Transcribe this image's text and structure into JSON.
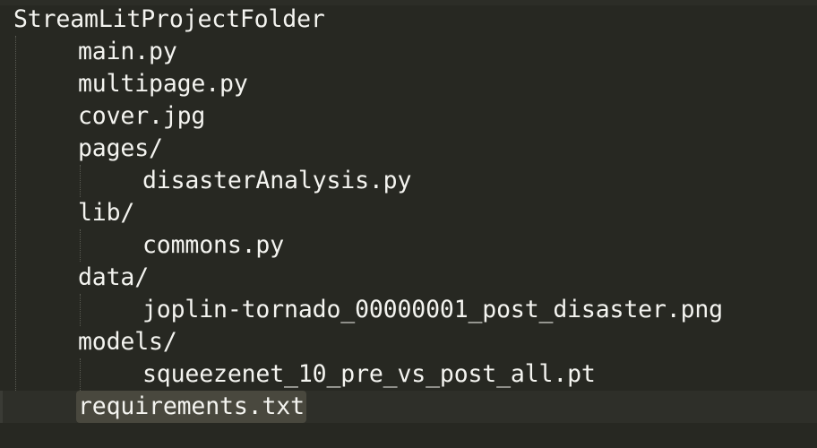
{
  "editor": {
    "lines": [
      {
        "text": "StreamLitProjectFolder",
        "indent": 0
      },
      {
        "text": "main.py",
        "indent": 1
      },
      {
        "text": "multipage.py",
        "indent": 1
      },
      {
        "text": "cover.jpg",
        "indent": 1
      },
      {
        "text": "pages/",
        "indent": 1
      },
      {
        "text": "disasterAnalysis.py",
        "indent": 2
      },
      {
        "text": "lib/",
        "indent": 1
      },
      {
        "text": "commons.py",
        "indent": 2
      },
      {
        "text": "data/",
        "indent": 1
      },
      {
        "text": "joplin-tornado_00000001_post_disaster.png",
        "indent": 2
      },
      {
        "text": "models/",
        "indent": 1
      },
      {
        "text": "squeezenet_10_pre_vs_post_all.pt",
        "indent": 2
      },
      {
        "text": "requirements.txt",
        "indent": 1,
        "selected": true
      }
    ]
  },
  "colors": {
    "background": "#272822",
    "text": "#f4f4f0",
    "selection": "#49483e",
    "indent_guide": "#5a5b53"
  }
}
